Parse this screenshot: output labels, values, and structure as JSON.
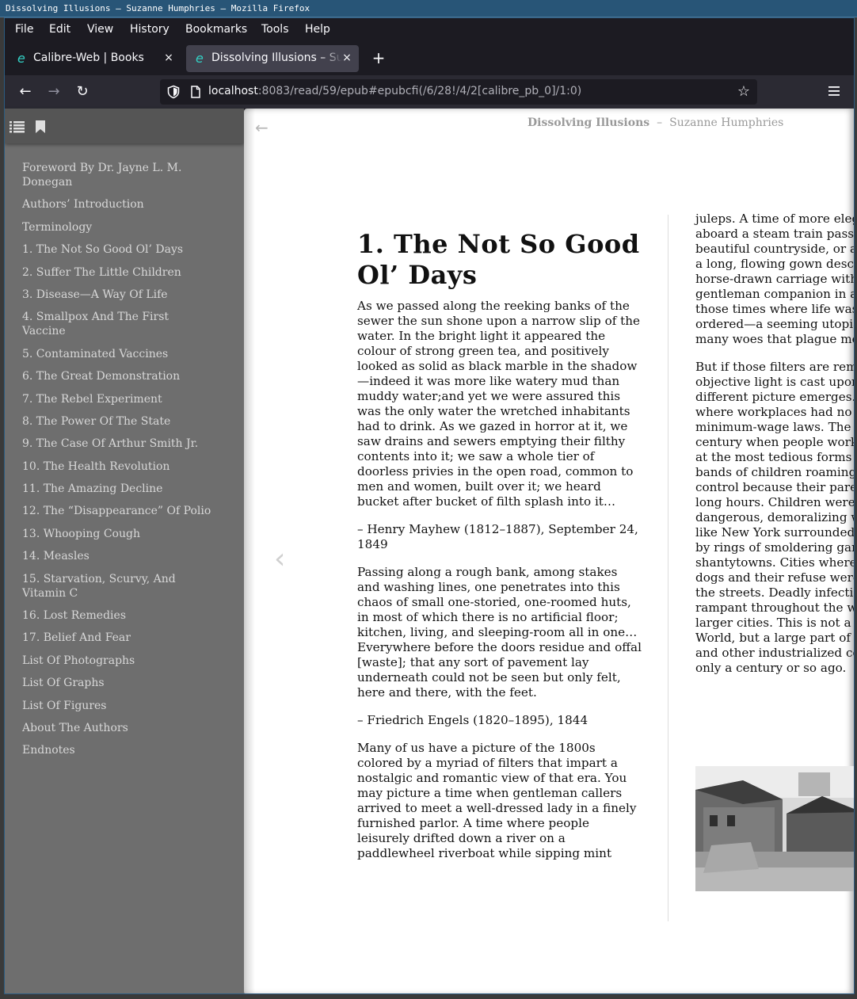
{
  "window": {
    "title": "Dissolving Illusions — Suzanne Humphries — Mozilla Firefox"
  },
  "menubar": {
    "items": [
      {
        "label": "File"
      },
      {
        "label": "Edit"
      },
      {
        "label": "View"
      },
      {
        "label": "History"
      },
      {
        "label": "Bookmarks"
      },
      {
        "label": "Tools"
      },
      {
        "label": "Help"
      }
    ]
  },
  "tabs": [
    {
      "label": "Calibre-Web | Books",
      "close": "×"
    },
    {
      "label": "Dissolving Illusions – Suzanne Humphries",
      "close": "×"
    }
  ],
  "newtab": "+",
  "navbar": {
    "url_host": "localhost",
    "url_rest": ":8083/read/59/epub#epubcfi(/6/28!/4/2[calibre_pb_0]/1:0)"
  },
  "sidebar": {
    "toc": [
      "Foreword By Dr. Jayne L. M. Donegan",
      "Authors’ Introduction",
      "Terminology",
      "1. The Not So Good Ol’ Days",
      "2. Suffer The Little Children",
      "3. Disease—A Way Of Life",
      "4. Smallpox And The First Vaccine",
      "5. Contaminated Vaccines",
      "6. The Great Demonstration",
      "7. The Rebel Experiment",
      "8. The Power Of The State",
      "9. The Case Of Arthur Smith Jr.",
      "10. The Health Revolution",
      "11. The Amazing Decline",
      "12. The “Disappearance” Of Polio",
      "13. Whooping Cough",
      "14. Measles",
      "15. Starvation, Scurvy, And Vitamin C",
      "16. Lost Remedies",
      "17. Belief And Fear",
      "List Of Photographs",
      "List Of Graphs",
      "List Of Figures",
      "About The Authors",
      "Endnotes"
    ]
  },
  "reader": {
    "back_arrow": "←",
    "book_title": "Dissolving Illusions",
    "separator": "–",
    "author": "Suzanne Humphries",
    "prev_arrow": "‹",
    "page1": {
      "heading": "1. The Not So Good Ol’ Days",
      "paragraphs": [
        "As we passed along the reeking banks of the sewer the sun shone upon a narrow slip of the water. In the bright light it appeared the colour of strong green tea, and positively looked as solid as black marble in the shadow—indeed it was more like watery mud than muddy water;and yet we were assured this was the only water the wretched inhabitants had to drink. As we gazed in horror at it, we saw drains and sewers emptying their filthy contents into it; we saw a whole tier of doorless privies in the open road, common to men and women, built over it; we heard bucket after bucket of filth splash into it…",
        "– Henry Mayhew (1812–1887), September 24, 1849",
        "Passing along a rough bank, among stakes and washing lines, one penetrates into this chaos of small one-storied, one-roomed huts, in most of which there is no artificial floor; kitchen, living, and sleeping-room all in one… Everywhere before the doors residue and offal [waste]; that any sort of pavement lay underneath could not be seen but only felt, here and there, with the feet.",
        "– Friedrich Engels (1820–1895), 1844",
        "Many of us have a picture of the 1800s colored by a myriad of filters that impart a nostalgic and romantic view of that era. You may picture a time when gentleman callers arrived to meet a well-dressed lady in a finely furnished parlor. A time where people leisurely drifted down a river on a paddlewheel riverboat while sipping mint"
      ]
    },
    "page2": {
      "paragraphs": [
        "juleps. A time of more elegance, of people aboard a steam train passing through beautiful countryside, or a fine lady dressed in a long, flowing gown descending from a sleek horse-drawn carriage with the aid of a gentleman companion in a top hat. We picture those times where life was more simple and ordered—a seeming utopia free from the many woes that plague modern society.",
        "But if those filters are removed and an objective light is cast upon that era, a different picture emerges. Imagine a world where workplaces had no concept of safety, or minimum-wage laws. The 1800s was a century when people worked 16 hours a day at the most tedious forms of labor. Imagine bands of children roaming the streets out of control because their parents were laboring long hours. Children were also involved in dangerous, demoralizing work. Picture cities like New York surrounded not by suburbs but by rings of smoldering garbage dumps and shantytowns. Cities where horses, cows, and dogs and their refuse were commonplace in the streets. Deadly infectious diseases were rampant throughout the world, particularly in larger cities. This is not a picture of the Third World, but a large part of the United States and other industrialized countries used to be only a century or so ago."
      ]
    }
  }
}
